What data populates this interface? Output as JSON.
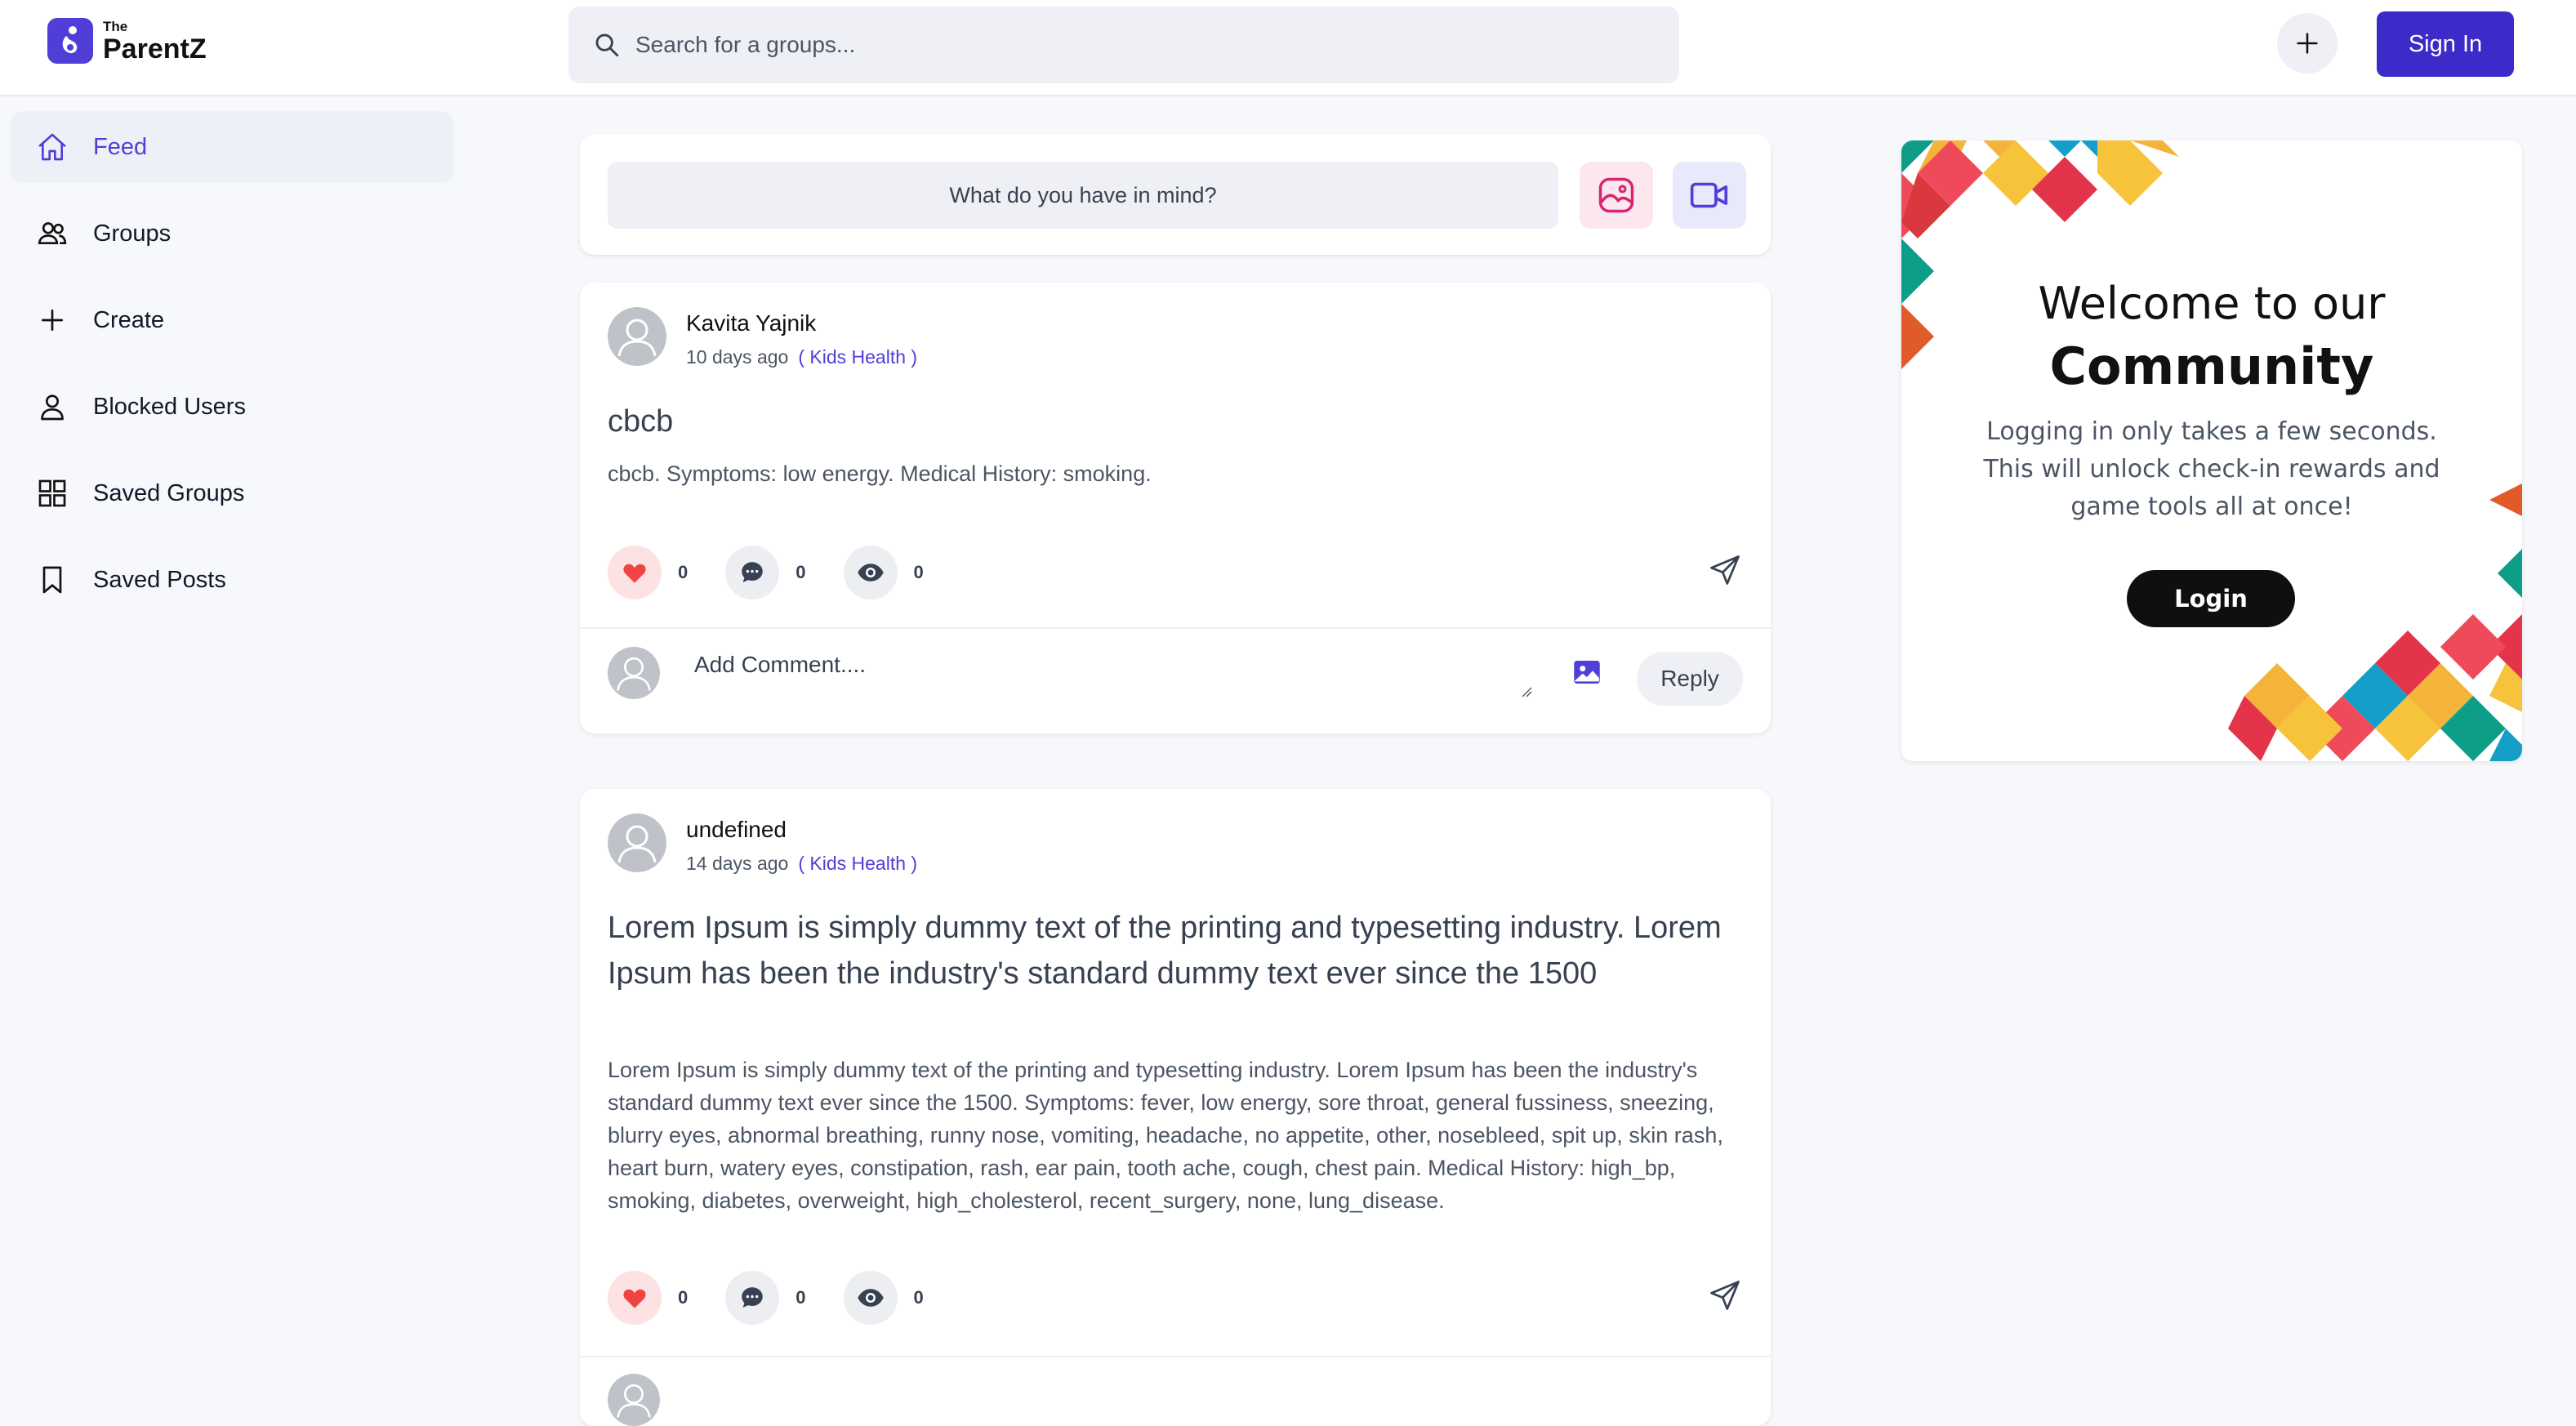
{
  "brand": {
    "small": "The",
    "name": "ParentZ",
    "color": "#4f3fd8"
  },
  "search": {
    "placeholder": "Search for a groups..."
  },
  "header": {
    "signin_label": "Sign In"
  },
  "sidebar": {
    "items": [
      {
        "label": "Feed",
        "icon": "home-icon",
        "active": true
      },
      {
        "label": "Groups",
        "icon": "users-icon"
      },
      {
        "label": "Create",
        "icon": "plus-icon"
      },
      {
        "label": "Blocked Users",
        "icon": "user-icon"
      },
      {
        "label": "Saved Groups",
        "icon": "grid-icon"
      },
      {
        "label": "Saved Posts",
        "icon": "bookmark-icon"
      }
    ]
  },
  "composer": {
    "placeholder": "What do you have in mind?"
  },
  "posts": [
    {
      "author": "Kavita Yajnik",
      "time": "10 days ago",
      "group": "( Kids Health )",
      "title": "cbcb",
      "body": "cbcb. Symptoms: low energy. Medical History: smoking.",
      "likes": "0",
      "comments": "0",
      "views": "0",
      "comment_placeholder": "Add Comment....",
      "reply_label": "Reply"
    },
    {
      "author": "undefined",
      "time": "14 days ago",
      "group": "( Kids Health )",
      "title": "Lorem Ipsum is simply dummy text of the printing and typesetting industry. Lorem Ipsum has been the industry's standard dummy text ever since the 1500",
      "body": "Lorem Ipsum is simply dummy text of the printing and typesetting industry. Lorem Ipsum has been the industry's standard dummy text ever since the 1500. Symptoms: fever, low energy, sore throat, general fussiness, sneezing, blurry eyes, abnormal breathing, runny nose, vomiting, headache, no appetite, other, nosebleed, spit up, skin rash, heart burn, watery eyes, constipation, rash, ear pain, tooth ache, cough, chest pain. Medical History: high_bp, smoking, diabetes, overweight, high_cholesterol, recent_surgery, none, lung_disease.",
      "likes": "0",
      "comments": "0",
      "views": "0"
    }
  ],
  "welcome": {
    "title_line1": "Welcome to our",
    "title_line2": "Community",
    "text": "Logging in only takes a few seconds. This will unlock check-in rewards and game tools all at once!",
    "login_label": "Login"
  },
  "colors": {
    "accent": "#3d2bc9",
    "like": "#ef4444",
    "group_link": "#4f3fd8"
  }
}
